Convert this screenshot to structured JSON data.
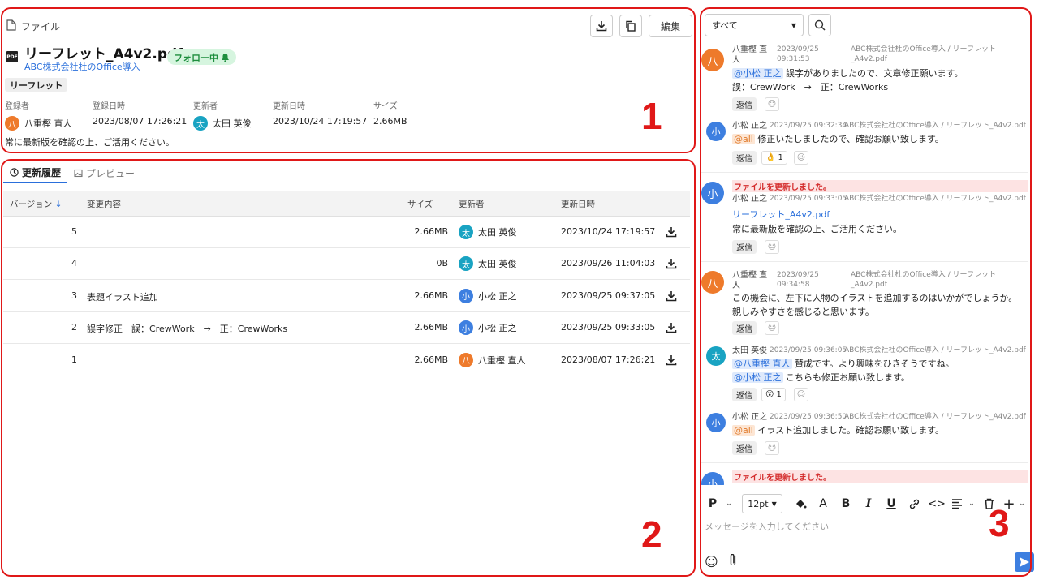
{
  "header": {
    "crumb": "ファイル",
    "edit_label": "編集",
    "file_name": "リーフレット_A4v2.pdf",
    "pdf_badge": "PDF",
    "follow_label": "フォロー中",
    "project": "ABC株式会社杜のOffice導入",
    "tag": "リーフレット",
    "meta": {
      "registrant_h": "登録者",
      "registrant": "八重樫 直人",
      "reg_date_h": "登録日時",
      "reg_date": "2023/08/07 17:26:21",
      "updater_h": "更新者",
      "updater": "太田 英俊",
      "upd_date_h": "更新日時",
      "upd_date": "2023/10/24 17:19:57",
      "size_h": "サイズ",
      "size": "2.66MB"
    },
    "note": "常に最新版を確認の上、ご活用ください。"
  },
  "tabs": {
    "history": "更新履歴",
    "preview": "プレビュー"
  },
  "table": {
    "headers": {
      "version": "バージョン",
      "change": "変更内容",
      "size": "サイズ",
      "updater": "更新者",
      "date": "更新日時"
    },
    "rows": [
      {
        "version": "5",
        "change": "",
        "size": "2.66MB",
        "avatar": "太",
        "color": "teal",
        "user": "太田 英俊",
        "date": "2023/10/24 17:19:57"
      },
      {
        "version": "4",
        "change": "",
        "size": "0B",
        "avatar": "太",
        "color": "teal",
        "user": "太田 英俊",
        "date": "2023/09/26 11:04:03"
      },
      {
        "version": "3",
        "change": "表題イラスト追加",
        "size": "2.66MB",
        "avatar": "小",
        "color": "blue",
        "user": "小松 正之",
        "date": "2023/09/25 09:37:05"
      },
      {
        "version": "2",
        "change": "誤字修正　誤：CrewWork　→　正：CrewWorks",
        "size": "2.66MB",
        "avatar": "小",
        "color": "blue",
        "user": "小松 正之",
        "date": "2023/09/25 09:33:05"
      },
      {
        "version": "1",
        "change": "",
        "size": "2.66MB",
        "avatar": "八",
        "color": "orange",
        "user": "八重樫 直人",
        "date": "2023/08/07 17:26:21"
      }
    ]
  },
  "chat": {
    "filter": "すべて",
    "reply": "返信",
    "system_update": "ファイルを更新しました。",
    "m1": {
      "avatar": "八",
      "name": "八重樫 直\n人",
      "date": "2023/09/25\n09:31:53",
      "path": "ABC株式会社杜のOffice導入 / リーフレット\n_A4v2.pdf",
      "mention": "@小松 正之",
      "text1": " 誤字がありましたので、文章修正願います。",
      "text2": "誤：CrewWork　→　正：CrewWorks"
    },
    "m2": {
      "avatar": "小",
      "name": "小松 正之",
      "date": "2023/09/25 09:32:34",
      "path": "ABC株式会社杜のOffice導入 / リーフレット_A4v2.pdf",
      "mention": "@all",
      "text": " 修正いたしましたので、確認お願い致します。",
      "react_emoji": "👌",
      "react_count": "1"
    },
    "m3": {
      "avatar": "小",
      "name": "小松 正之",
      "date": "2023/09/25 09:33:05",
      "path": "ABC株式会社杜のOffice導入 / リーフレット_A4v2.pdf",
      "link": "リーフレット_A4v2.pdf",
      "text": "常に最新版を確認の上、ご活用ください。"
    },
    "m4": {
      "avatar": "八",
      "name": "八重樫 直\n人",
      "date": "2023/09/25\n09:34:58",
      "path": "ABC株式会社杜のOffice導入 / リーフレット\n_A4v2.pdf",
      "text": "この機会に、左下に人物のイラストを追加するのはいかがでしょうか。親しみやすさを感じると思います。"
    },
    "m5": {
      "avatar": "太",
      "name": "太田 英俊",
      "date": "2023/09/25 09:36:05",
      "path": "ABC株式会社杜のOffice導入 / リーフレット_A4v2.pdf",
      "mention1": "@八重樫 直人",
      "text1": " 賛成です。より興味をひきそうですね。",
      "mention2": "@小松 正之",
      "text2": " こちらも修正お願い致します。",
      "react_emoji": "😮",
      "react_count": "1"
    },
    "m6": {
      "avatar": "小",
      "name": "小松 正之",
      "date": "2023/09/25 09:36:50",
      "path": "ABC株式会社杜のOffice導入 / リーフレット_A4v2.pdf",
      "mention": "@all",
      "text": " イラスト追加しました。確認お願い致します。"
    },
    "m7": {
      "avatar": "小"
    }
  },
  "editor": {
    "para": "P",
    "font_size": "12pt",
    "placeholder": "メッセージを入力してください"
  },
  "annotations": {
    "n1": "1",
    "n2": "2",
    "n3": "3"
  },
  "colors": {
    "accent": "#2a6fdb",
    "annotation_red": "#e01818",
    "orange_avatar": "#ee7a2b",
    "teal_avatar": "#19a3c2",
    "blue_avatar": "#3d7fe0"
  }
}
